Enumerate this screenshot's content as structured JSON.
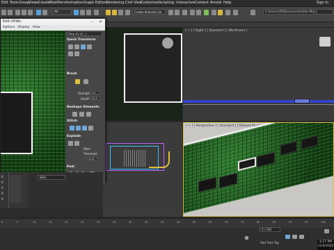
{
  "menubar": {
    "items": [
      "Edit",
      "Tools",
      "Group",
      "Views",
      "Create",
      "Modifiers",
      "Animation",
      "Graph Editors",
      "Rendering",
      "Civil View",
      "Customize",
      "Scripting",
      "Interactive",
      "Content",
      "Arnold",
      "Help"
    ],
    "signin": "Sign In"
  },
  "toolbar": {
    "filter_select": "All",
    "named_selection": "Create Selection Se",
    "path": "C:\\Users\\ID\\Documents\\3ds Max 2022",
    "search": ""
  },
  "uv_editor": {
    "title": "Edit UVWs",
    "menu": [
      "Options",
      "Display",
      "View"
    ],
    "map_channel": "Map #1 (U…)",
    "rollouts": {
      "quick_transform": "Quick Transform",
      "brush": "Brush",
      "brush_strength_label": "Strength",
      "brush_strength": "0.0",
      "brush_falloff_label": "Falloff",
      "brush_falloff": "20.0",
      "reshape": "Reshape Elements",
      "stitch": "Stitch",
      "explode": "Explode",
      "threshold_label": "Threshold",
      "threshold": "0.01",
      "weld_label": "Weld",
      "peel": "Peel"
    },
    "bottom_field": "XY",
    "bottom_field2": "0.0"
  },
  "viewports": {
    "top_right_label": "[ + ] [ Right ] [ Standard ] [ Wireframe ]",
    "bottom_right_label": "[ + ] [ Perspective ] [ Standard ] [ Default Shading ]"
  },
  "left_panel": {
    "list_items": [
      "0",
      "0",
      "0",
      "0",
      "0"
    ],
    "field": "SEEs"
  },
  "timeline": {
    "ticks": [
      "0",
      "5",
      "10",
      "15",
      "20",
      "25",
      "30",
      "35",
      "40",
      "45",
      "50",
      "55",
      "60",
      "65",
      "70",
      "75",
      "80",
      "85",
      "90",
      "95",
      "100"
    ],
    "frame": "0 / 100"
  },
  "status": {
    "add_time_tag": "Add Time Tag",
    "clock_time": "3:27 PM",
    "clock_date": "11/4/2022"
  },
  "colors": {
    "accent_blue": "#5aa0d8",
    "selection_yellow": "#d8c040",
    "pcb_green": "#2f7a2f"
  }
}
